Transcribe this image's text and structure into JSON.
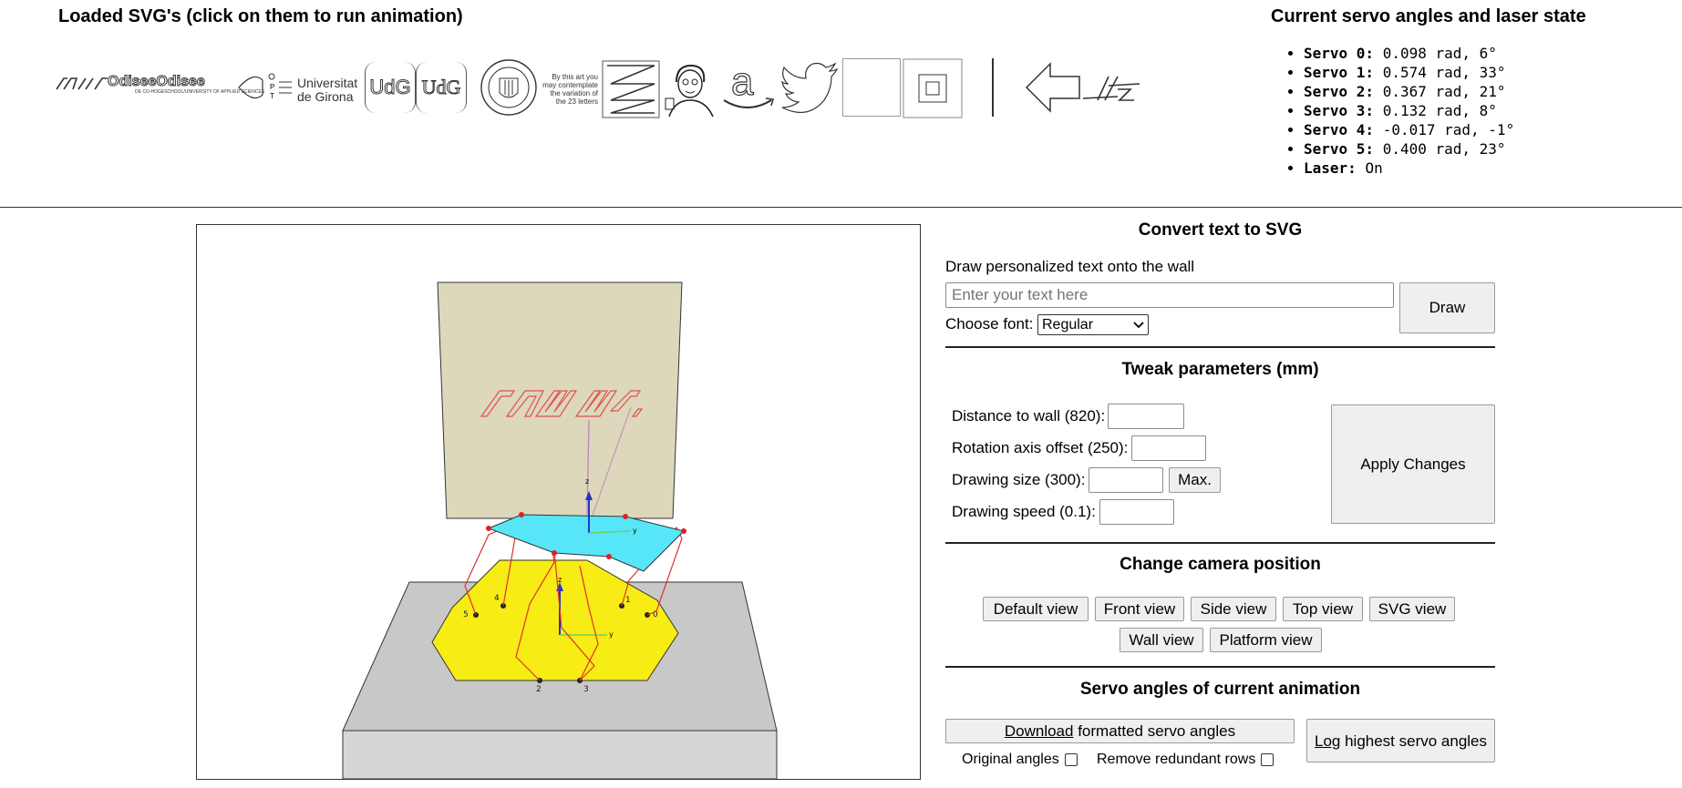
{
  "loaded_svgs": {
    "title": "Loaded SVG's (click on them to run animation)",
    "items": [
      {
        "name": "raww-logo",
        "text": "ᐟᐟᐟ raw"
      },
      {
        "name": "odisee-logo",
        "text": "OdiseeOdisee",
        "sub": "DE CO-HOGESCHOOL/UNIVERSITY OF APPLIED SCIENCES"
      },
      {
        "name": "opt-logo",
        "text": "O P T"
      },
      {
        "name": "universitat-girona-logo",
        "text": "Universitat de Girona"
      },
      {
        "name": "udg-outline-logo",
        "text": "UdG"
      },
      {
        "name": "udg-serif-logo",
        "text": "UdG"
      },
      {
        "name": "upv-seal-logo",
        "text": "UNIVERSITAT POLITÈCNICA VALÈNCIA"
      },
      {
        "name": "23-letters-text",
        "lines": [
          "By this art you",
          "may contemplate",
          "the variation of",
          "the 23 letters"
        ]
      },
      {
        "name": "zigzag-square",
        "text": ""
      },
      {
        "name": "portrait-drawing",
        "text": ""
      },
      {
        "name": "amazon-logo",
        "text": "a"
      },
      {
        "name": "twitter-logo",
        "text": ""
      },
      {
        "name": "blank-square",
        "text": ""
      },
      {
        "name": "nested-squares",
        "text": ""
      },
      {
        "name": "vertical-line",
        "text": ""
      },
      {
        "name": "arrow-left",
        "text": ""
      },
      {
        "name": "hz-signature",
        "text": "Hz"
      }
    ]
  },
  "servo_state": {
    "title": "Current servo angles and laser state",
    "items": [
      {
        "label": "Servo 0:",
        "value": "0.098 rad, 6°"
      },
      {
        "label": "Servo 1:",
        "value": "0.574 rad, 33°"
      },
      {
        "label": "Servo 2:",
        "value": "0.367 rad, 21°"
      },
      {
        "label": "Servo 3:",
        "value": "0.132 rad, 8°"
      },
      {
        "label": "Servo 4:",
        "value": "-0.017 rad, -1°"
      },
      {
        "label": "Servo 5:",
        "value": "0.400 rad, 23°"
      },
      {
        "label": "Laser:",
        "value": "On"
      }
    ]
  },
  "scene": {
    "axis_z": "z",
    "axis_y": "y",
    "wall_text": "ᐟᐟᐟ raw",
    "base_joint_labels": [
      "5",
      "4",
      "1",
      "0",
      "2",
      "3"
    ]
  },
  "convert_text": {
    "title": "Convert text to SVG",
    "description": "Draw personalized text onto the wall",
    "placeholder": "Enter your text here",
    "font_label": "Choose font:",
    "font_selected": "Regular",
    "draw_button": "Draw"
  },
  "tweak": {
    "title": "Tweak parameters (mm)",
    "distance_label": "Distance to wall (820):",
    "rotation_label": "Rotation axis offset (250):",
    "size_label": "Drawing size (300):",
    "max_button": "Max.",
    "speed_label": "Drawing speed (0.1):",
    "apply_button": "Apply Changes"
  },
  "camera": {
    "title": "Change camera position",
    "buttons": [
      "Default view",
      "Front view",
      "Side view",
      "Top view",
      "SVG view",
      "Wall view",
      "Platform view"
    ]
  },
  "servo_anim": {
    "title": "Servo angles of current animation",
    "download_link": "Download",
    "download_rest": " formatted servo angles",
    "log_link": "Log",
    "log_rest": " highest servo angles",
    "original_label": "Original angles",
    "redundant_label": "Remove redundant rows"
  },
  "colors": {
    "wall": "#ddd7bb",
    "platform": "#57e6f7",
    "base_hexagon": "#f7ec14",
    "floor": "#c9c9c9",
    "leg": "#e03030"
  }
}
